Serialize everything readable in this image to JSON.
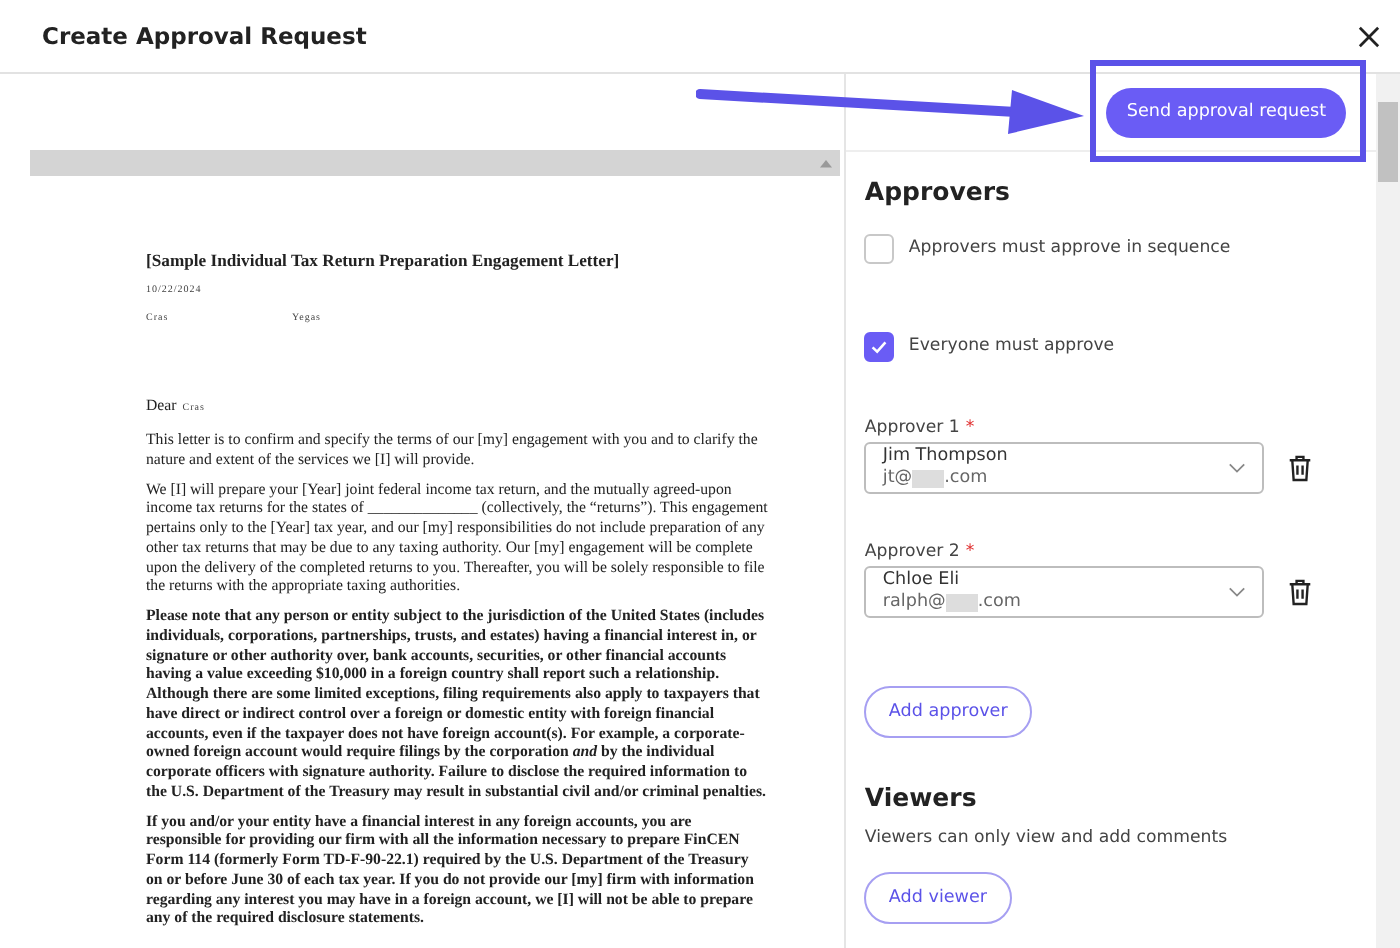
{
  "window": {
    "title": "Create Approval Request"
  },
  "send_button": {
    "label": "Send approval request",
    "highlighted": true
  },
  "document": {
    "heading": "[Sample Individual Tax Return Preparation Engagement Letter]",
    "date": "10/22/2024",
    "field_1": "Cras",
    "field_2": "Yegas",
    "salutation": "Dear",
    "salutation_name": "Cras",
    "paragraphs": [
      {
        "bold": false,
        "text": "This letter is to confirm and specify the terms of our [my] engagement with you and to clarify the nature and extent of the services we [I] will provide."
      },
      {
        "bold": false,
        "text": "We [I] will prepare your [Year] joint federal income tax return, and the mutually agreed-upon income tax returns for the states of ______________ (collectively, the “returns”).  This engagement pertains only to the [Year] tax year, and our [my] responsibilities do not include preparation of any other tax returns that may be due to any taxing authority.  Our [my] engagement will be complete upon the delivery of the completed returns to you.  Thereafter, you will be solely responsible to file the returns with the appropriate taxing authorities."
      },
      {
        "bold": true,
        "text": "Please note that any person or entity subject to the jurisdiction of the United States (includes individuals, corporations, partnerships, trusts, and estates) having a financial interest in, or signature or other authority over, bank accounts, securities, or other financial accounts having a value exceeding $10,000 in a foreign country shall report such a relationship. Although there are some limited exceptions, filing requirements also apply to taxpayers that have direct or indirect control over a foreign or domestic entity with foreign financial accounts, even if the taxpayer does not have foreign account(s). For example, a corporate-owned foreign account would require filings by the corporation *and* by the individual corporate officers with signature authority. Failure to disclose the required information to the U.S. Department of the Treasury may result in substantial civil and/or criminal penalties."
      },
      {
        "bold": true,
        "text": "If you and/or your entity have a financial interest in any foreign accounts, you are responsible for providing our firm with all the information necessary to prepare FinCEN Form 114 (formerly Form TD-F-90-22.1) required by the U.S. Department of the Treasury on or before June 30 of each tax year. If you do not provide our [my] firm with information regarding any interest you may have in a foreign account, we [I] will not be able to prepare any of the required disclosure statements."
      }
    ]
  },
  "approvers": {
    "heading": "Approvers",
    "options": [
      {
        "label": "Approvers must approve in sequence",
        "checked": false
      },
      {
        "label": "Everyone must approve",
        "checked": true
      }
    ],
    "list": [
      {
        "label": "Approver 1",
        "required": "*",
        "name": "Jim Thompson",
        "email_start": "jt@",
        "email_end": ".com"
      },
      {
        "label": "Approver 2",
        "required": "*",
        "name": "Chloe Eli",
        "email_start": "ralph@",
        "email_end": ".com"
      }
    ],
    "add_button": "Add approver"
  },
  "viewers": {
    "heading": "Viewers",
    "description": "Viewers can only view and add comments",
    "add_button": "Add viewer"
  }
}
